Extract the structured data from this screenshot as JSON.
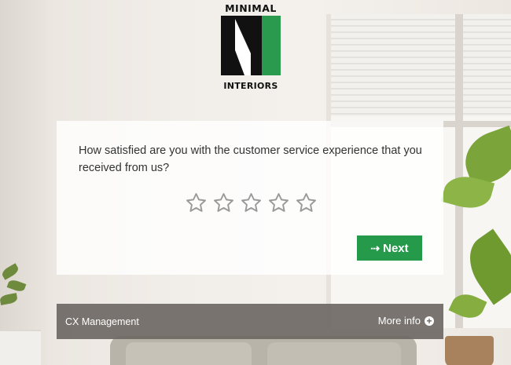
{
  "logo": {
    "top_word": "MINIMAL",
    "bottom_word": "INTERIORS",
    "accent_color": "#2a9a4f",
    "dark_color": "#111111"
  },
  "survey": {
    "question": "How satisfied are you with the customer service experience that you received from us?",
    "rating": {
      "max": 5,
      "selected": 0
    },
    "star_icon": "star-outline-icon",
    "next_label": "Next",
    "next_icon": "arrow-right-icon",
    "next_color": "#269a4b"
  },
  "footer": {
    "brand": "CX Management",
    "more_label": "More info",
    "more_icon": "plus-circle-icon"
  }
}
